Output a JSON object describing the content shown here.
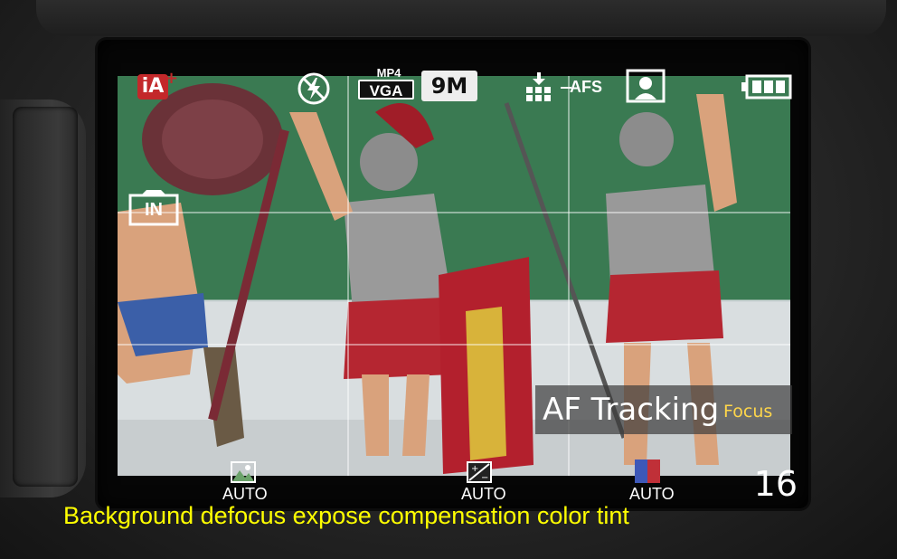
{
  "top_bar": {
    "ia_mode": "iA",
    "ia_plus": "+",
    "flash_icon": "flash-off-icon",
    "movie_format": "MP4",
    "movie_quality": "VGA",
    "picture_size": "9M",
    "quality_icon": "quality-icon",
    "af_mode": "AFS",
    "af_area_icon": "face-detect-icon",
    "battery_icon": "battery-icon"
  },
  "side_indicator": {
    "icon": "intelligent-iso-icon",
    "label": "IN"
  },
  "af_overlay": {
    "main": "AF Tracking",
    "sub": "Focus"
  },
  "bottom_bar": {
    "items": [
      {
        "icon": "background-defocus-icon",
        "label": "AUTO"
      },
      {
        "icon": "exposure-compensation-icon",
        "label": "AUTO"
      },
      {
        "icon": "color-tint-icon",
        "label": "AUTO"
      }
    ],
    "shots_remaining": "16"
  },
  "caption": "Background defocus expose compensation color tint",
  "colors": {
    "ia_red": "#c3282a",
    "caption_yellow": "#ffff00",
    "focus_yellow": "#ffd64a"
  }
}
